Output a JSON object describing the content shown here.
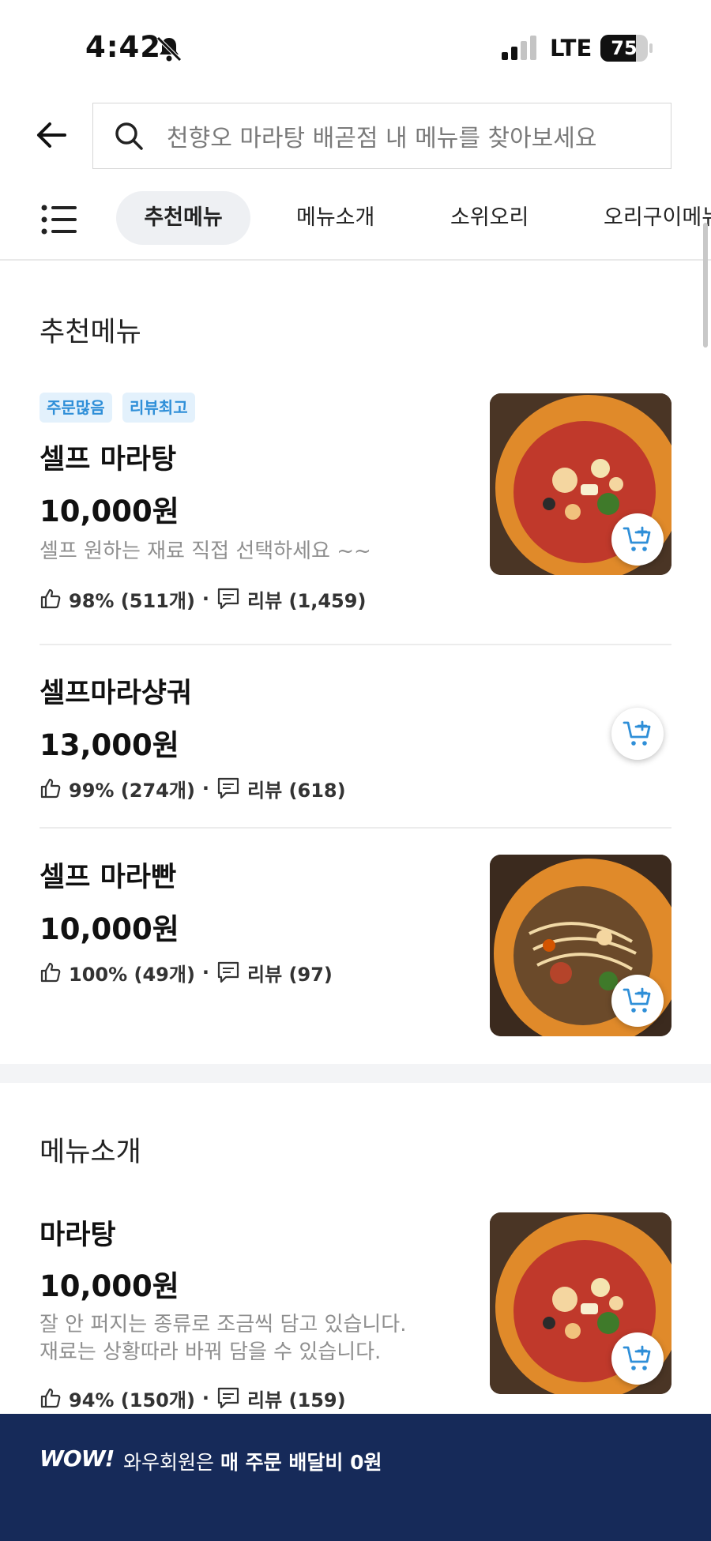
{
  "status_bar": {
    "time": "4:42",
    "network": "LTE",
    "battery": "75",
    "battery_level": 0.75
  },
  "search": {
    "placeholder": "천향오 마라탕 배곧점 내 메뉴를 찾아보세요"
  },
  "tabs": [
    {
      "label": "추천메뉴",
      "active": true
    },
    {
      "label": "메뉴소개",
      "active": false
    },
    {
      "label": "소위오리",
      "active": false
    },
    {
      "label": "오리구이메뉴",
      "active": false
    }
  ],
  "sections": [
    {
      "title": "추천메뉴",
      "items": [
        {
          "badges": [
            "주문많음",
            "리뷰최고"
          ],
          "name": "셀프 마라탕",
          "price": "10,000원",
          "description": "셀프 원하는 재료 직접 선택하세요  ~~",
          "rating": "98% (511개)",
          "reviews": "리뷰 (1,459)",
          "has_image": true
        },
        {
          "badges": [],
          "name": "셀프마라샹궈",
          "price": "13,000원",
          "description": "",
          "rating": "99% (274개)",
          "reviews": "리뷰 (618)",
          "has_image": false
        },
        {
          "badges": [],
          "name": "셀프 마라빤",
          "price": "10,000원",
          "description": "",
          "rating": "100% (49개)",
          "reviews": "리뷰 (97)",
          "has_image": true
        }
      ]
    },
    {
      "title": "메뉴소개",
      "items": [
        {
          "badges": [],
          "name": "마라탕",
          "price": "10,000원",
          "description": [
            "잘 안 퍼지는 종류로 조금씩 담고 있습니다.",
            "재료는 상황따라 바꿔 담을 수 있습니다."
          ],
          "rating": "94% (150개)",
          "reviews": "리뷰 (159)",
          "has_image": true
        }
      ]
    }
  ],
  "banner": {
    "logo": "WOW!",
    "text_prefix": "와우회원은 ",
    "text_bold": "매 주문 배달비 0원"
  },
  "icons": {
    "back": "back-arrow-icon",
    "search": "search-icon",
    "menu": "menu-list-icon",
    "like": "thumbs-up-icon",
    "review": "comment-icon",
    "cart": "add-to-cart-icon",
    "mute": "bell-slash-icon"
  },
  "colors": {
    "accent": "#2f8fd8",
    "badge_bg": "#e3f1fc",
    "banner_bg": "#162a59"
  }
}
